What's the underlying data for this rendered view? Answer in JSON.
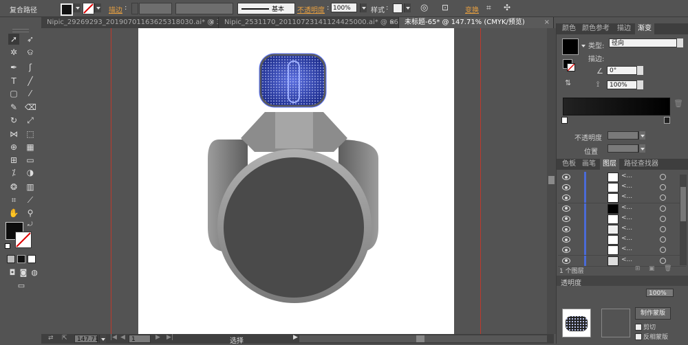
{
  "control_bar": {
    "object_type": "复合路径",
    "stroke_label": "描边",
    "stroke_colon": ":",
    "stroke_profile": "基本",
    "opacity_label": "不透明度",
    "opacity_colon": ":",
    "opacity_value": "100%",
    "style_label": "样式",
    "style_colon": ":",
    "transform_label": "变换"
  },
  "tabs": [
    {
      "label": "Nipic_29269293_20190701163625318030.ai* @ 33..."
    },
    {
      "label": "Nipic_2531170_20110723141124425000.ai* @ 66..."
    },
    {
      "label": "未标题-65* @ 147.71% (CMYK/预览)"
    }
  ],
  "tab_close": "×",
  "status": {
    "zoom": "147.71",
    "page": "1",
    "tool_name": "选择"
  },
  "gradient_panel": {
    "tabs": [
      "颜色",
      "颜色参考",
      "描边",
      "渐变"
    ],
    "type_label": "类型:",
    "type_value": "径向",
    "stroke_label": "描边:",
    "angle_value": "0°",
    "aspect_value": "100%",
    "opacity_label": "不透明度",
    "location_label": "位置"
  },
  "layers_panel": {
    "tabs": [
      "色板",
      "画笔",
      "图层",
      "路径查找器"
    ],
    "layer_count": "1 个图层",
    "row_name": "<...",
    "row_count": 9
  },
  "transparency_panel": {
    "title": "透明度",
    "opacity_value": "100%",
    "make_mask_button": "制作蒙版",
    "clip_label": "剪切",
    "invert_mask_label": "反相蒙版"
  },
  "colors": {
    "guide_red": "#c0392b",
    "mic_blue": "#2c3fb0",
    "body_gray": "#8a8a8a",
    "face_dark": "#4a4a4a",
    "layer_blue": "#4a6bd8",
    "orange_label": "#e8a040"
  }
}
